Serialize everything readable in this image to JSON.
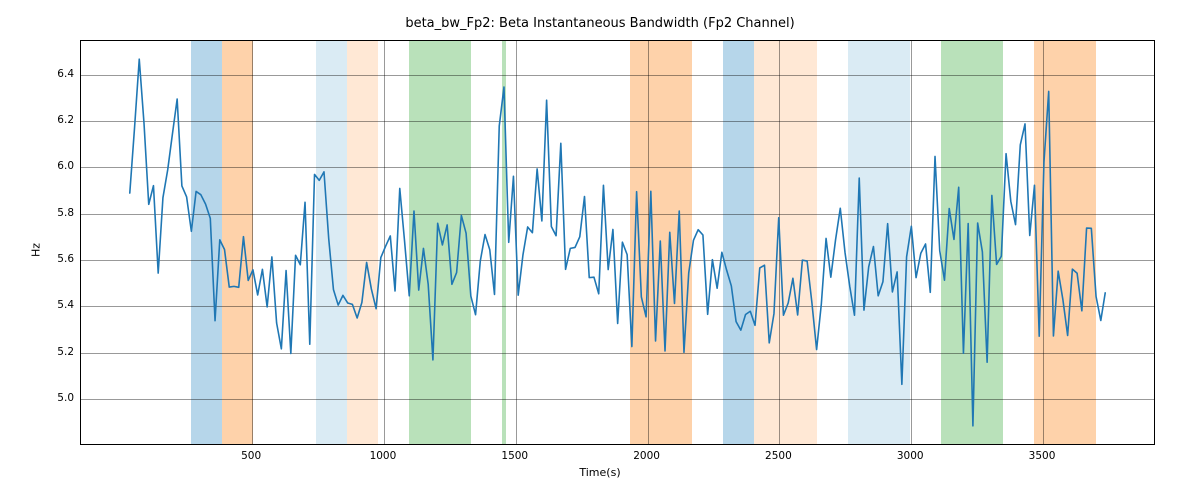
{
  "chart_data": {
    "type": "line",
    "title": "beta_bw_Fp2: Beta Instantaneous Bandwidth (Fp2 Channel)",
    "xlabel": "Time(s)",
    "ylabel": "Hz",
    "xlim": [
      -149.07,
      3928.47
    ],
    "ylim": [
      4.797,
      6.546
    ],
    "xticks": [
      500,
      1000,
      1500,
      2000,
      2500,
      3000,
      3500
    ],
    "yticks": [
      5.0,
      5.2,
      5.4,
      5.6,
      5.8,
      6.0,
      6.2,
      6.4
    ],
    "bands": [
      {
        "color": "#6daed5",
        "alpha": 0.5,
        "start": 268.2,
        "end": 386.7
      },
      {
        "color": "#fea556",
        "alpha": 0.5,
        "start": 386.7,
        "end": 505.2
      },
      {
        "color": "#6daed5",
        "alpha": 0.25,
        "start": 741.0,
        "end": 859.5
      },
      {
        "color": "#fea556",
        "alpha": 0.25,
        "start": 859.5,
        "end": 978.0
      },
      {
        "color": "#74c476",
        "alpha": 0.5,
        "start": 1095.3,
        "end": 1330.2
      },
      {
        "color": "#74c476",
        "alpha": 0.5,
        "start": 1448.7,
        "end": 1463.1
      },
      {
        "color": "#fea556",
        "alpha": 0.5,
        "start": 1933.2,
        "end": 2169.0
      },
      {
        "color": "#6daed5",
        "alpha": 0.5,
        "start": 2286.9,
        "end": 2405.4
      },
      {
        "color": "#fea556",
        "alpha": 0.25,
        "start": 2405.4,
        "end": 2641.2
      },
      {
        "color": "#6daed5",
        "alpha": 0.25,
        "start": 2758.5,
        "end": 2994.3
      },
      {
        "color": "#74c476",
        "alpha": 0.5,
        "start": 3112.2,
        "end": 3348.0
      },
      {
        "color": "#fea556",
        "alpha": 0.5,
        "start": 3466.5,
        "end": 3702.3
      }
    ],
    "x": [
      36.3,
      54.3,
      72.3,
      90.3,
      108.3,
      126.3,
      144.3,
      162.3,
      180.3,
      198.3,
      216.3,
      234.3,
      252.3,
      270.3,
      288.3,
      306.3,
      324.3,
      342.3,
      360.3,
      378.3,
      396.3,
      414.3,
      432.3,
      450.3,
      468.3,
      486.3,
      504.3,
      522.3,
      540.3,
      558.3,
      576.3,
      594.3,
      612.3,
      630.3,
      648.3,
      666.3,
      684.3,
      702.3,
      720.3,
      738.3,
      756.3,
      774.3,
      792.3,
      810.3,
      828.3,
      846.3,
      864.3,
      882.3,
      900.3,
      918.3,
      936.3,
      954.3,
      972.3,
      990.3,
      1008.3,
      1026.3,
      1044.3,
      1062.3,
      1080.3,
      1098.3,
      1116.3,
      1134.3,
      1152.3,
      1170.3,
      1188.3,
      1206.3,
      1224.3,
      1242.3,
      1260.3,
      1278.3,
      1296.3,
      1314.3,
      1332.3,
      1350.3,
      1368.3,
      1386.3,
      1404.3,
      1422.3,
      1440.3,
      1458.3,
      1476.3,
      1494.3,
      1512.3,
      1530.3,
      1548.3,
      1566.3,
      1584.3,
      1602.3,
      1620.3,
      1638.3,
      1656.3,
      1674.3,
      1692.3,
      1710.3,
      1728.3,
      1746.3,
      1764.3,
      1782.3,
      1800.3,
      1818.3,
      1836.3,
      1854.3,
      1872.3,
      1890.3,
      1908.3,
      1926.3,
      1944.3,
      1962.3,
      1980.3,
      1998.3,
      2016.3,
      2034.3,
      2052.3,
      2070.3,
      2088.3,
      2106.3,
      2124.3,
      2142.3,
      2160.3,
      2178.3,
      2196.3,
      2214.3,
      2232.3,
      2250.3,
      2268.3,
      2286.3,
      2304.3,
      2322.3,
      2340.3,
      2358.3,
      2376.3,
      2394.3,
      2412.3,
      2430.3,
      2448.3,
      2466.3,
      2484.3,
      2502.3,
      2520.3,
      2538.3,
      2556.3,
      2574.3,
      2592.3,
      2610.3,
      2628.3,
      2646.3,
      2664.3,
      2682.3,
      2700.3,
      2718.3,
      2736.3,
      2754.3,
      2772.3,
      2790.3,
      2808.3,
      2826.3,
      2844.3,
      2862.3,
      2880.3,
      2898.3,
      2916.3,
      2934.3,
      2952.3,
      2970.3,
      2988.3,
      3006.3,
      3024.3,
      3042.3,
      3060.3,
      3078.3,
      3096.3,
      3114.3,
      3132.3,
      3150.3,
      3168.3,
      3186.3,
      3204.3,
      3222.3,
      3240.3,
      3258.3,
      3276.3,
      3294.3,
      3312.3,
      3330.3,
      3348.3,
      3366.3,
      3384.3,
      3402.3,
      3420.3,
      3438.3,
      3456.3,
      3474.3,
      3492.3,
      3510.3,
      3528.3,
      3546.3,
      3564.3,
      3582.3,
      3600.3,
      3618.3,
      3636.3,
      3654.3,
      3672.3,
      3690.3,
      3708.3,
      3726.3,
      3743.1
    ],
    "y": [
      5.886,
      6.168,
      6.467,
      6.19,
      5.837,
      5.918,
      5.539,
      5.866,
      5.986,
      6.142,
      6.294,
      5.917,
      5.869,
      5.72,
      5.893,
      5.879,
      5.838,
      5.776,
      5.332,
      5.683,
      5.641,
      5.478,
      5.481,
      5.477,
      5.697,
      5.507,
      5.553,
      5.444,
      5.555,
      5.392,
      5.609,
      5.322,
      5.21,
      5.55,
      5.19,
      5.616,
      5.575,
      5.846,
      5.23,
      5.967,
      5.941,
      5.978,
      5.688,
      5.467,
      5.4,
      5.442,
      5.409,
      5.403,
      5.344,
      5.411,
      5.585,
      5.47,
      5.384,
      5.606,
      5.655,
      5.7,
      5.461,
      5.906,
      5.68,
      5.44,
      5.808,
      5.465,
      5.646,
      5.49,
      5.162,
      5.755,
      5.661,
      5.748,
      5.49,
      5.541,
      5.789,
      5.712,
      5.439,
      5.358,
      5.591,
      5.706,
      5.64,
      5.446,
      6.177,
      6.346,
      5.672,
      5.959,
      5.443,
      5.617,
      5.739,
      5.714,
      5.991,
      5.765,
      6.289,
      5.741,
      5.701,
      6.102,
      5.555,
      5.646,
      5.65,
      5.696,
      5.871,
      5.519,
      5.521,
      5.449,
      5.92,
      5.554,
      5.728,
      5.32,
      5.673,
      5.619,
      5.22,
      5.892,
      5.435,
      5.349,
      5.894,
      5.244,
      5.678,
      5.201,
      5.716,
      5.407,
      5.808,
      5.195,
      5.539,
      5.681,
      5.727,
      5.704,
      5.36,
      5.597,
      5.473,
      5.629,
      5.552,
      5.483,
      5.328,
      5.291,
      5.359,
      5.373,
      5.312,
      5.561,
      5.573,
      5.236,
      5.363,
      5.779,
      5.356,
      5.409,
      5.516,
      5.357,
      5.595,
      5.591,
      5.412,
      5.207,
      5.405,
      5.689,
      5.521,
      5.683,
      5.82,
      5.628,
      5.481,
      5.356,
      5.951,
      5.378,
      5.566,
      5.654,
      5.44,
      5.501,
      5.753,
      5.457,
      5.544,
      5.056,
      5.609,
      5.742,
      5.519,
      5.625,
      5.665,
      5.455,
      6.045,
      5.635,
      5.508,
      5.819,
      5.685,
      5.911,
      5.191,
      5.754,
      4.876,
      5.756,
      5.631,
      5.152,
      5.876,
      5.576,
      5.612,
      6.057,
      5.85,
      5.749,
      6.095,
      6.186,
      5.702,
      5.92,
      5.265,
      6.02,
      6.327,
      5.266,
      5.547,
      5.423,
      5.268,
      5.556,
      5.538,
      5.375,
      5.734,
      5.733,
      5.437,
      5.333,
      5.453
    ]
  }
}
